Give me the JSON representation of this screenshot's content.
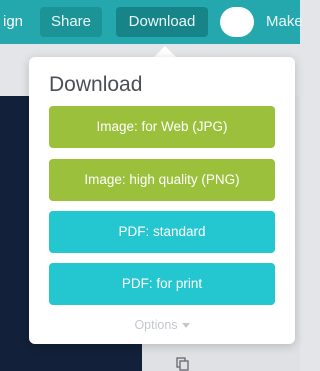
{
  "toolbar": {
    "design_label": "ign",
    "share_label": "Share",
    "download_label": "Download",
    "make_label": "Make"
  },
  "popup": {
    "title": "Download",
    "options": [
      {
        "label": "Image: for Web (JPG)",
        "color": "#9bc13c"
      },
      {
        "label": "Image: high quality (PNG)",
        "color": "#9bc13c"
      },
      {
        "label": "PDF: standard",
        "color": "#24c6cf"
      },
      {
        "label": "PDF: for print",
        "color": "#24c6cf"
      }
    ],
    "more_label": "Options"
  },
  "colors": {
    "toolbar": "#24a8ad",
    "canvas_dark": "#122039"
  }
}
